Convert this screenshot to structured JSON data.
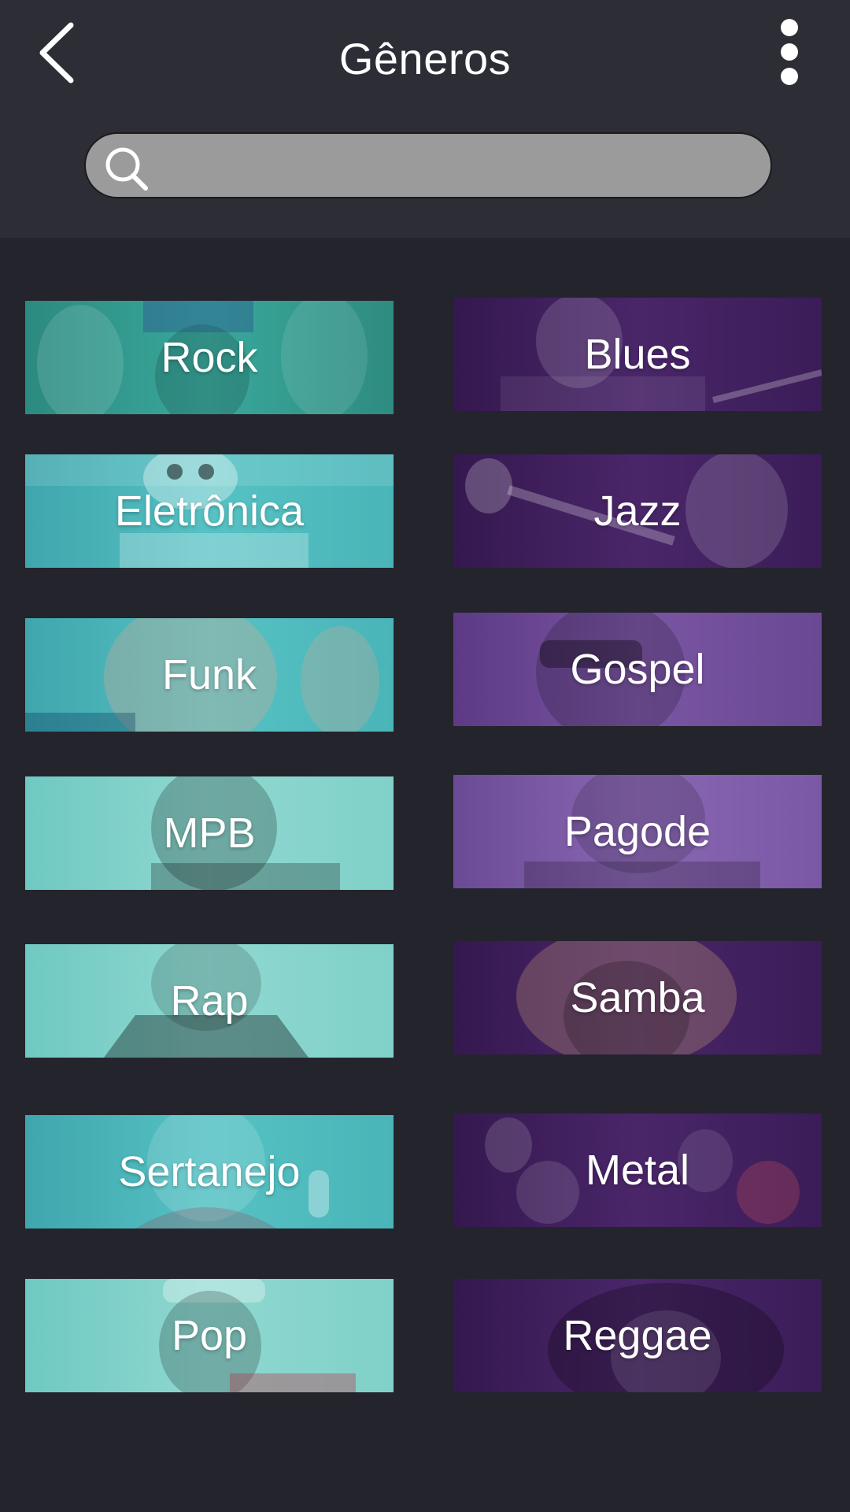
{
  "header": {
    "title": "Gêneros",
    "back_icon": "chevron-left-icon",
    "menu_icon": "more-vertical-icon"
  },
  "search": {
    "placeholder": "",
    "value": "",
    "icon": "search-icon"
  },
  "genres": [
    {
      "label": "Rock",
      "color": "#2f9185"
    },
    {
      "label": "Blues",
      "color": "#3d1d5a"
    },
    {
      "label": "Eletrônica",
      "color": "#3a9ba3"
    },
    {
      "label": "Jazz",
      "color": "#3e1f5c"
    },
    {
      "label": "Funk",
      "color": "#4ab8bb"
    },
    {
      "label": "Gospel",
      "color": "#7a55a3"
    },
    {
      "label": "MPB",
      "color": "#84d3cb"
    },
    {
      "label": "Pagode",
      "color": "#8462ad"
    },
    {
      "label": "Rap",
      "color": "#8bd6ce"
    },
    {
      "label": "Samba",
      "color": "#452566"
    },
    {
      "label": "Sertanejo",
      "color": "#58bfc0"
    },
    {
      "label": "Metal",
      "color": "#3a1c56"
    },
    {
      "label": "Pop",
      "color": "#8fd8d0"
    },
    {
      "label": "Reggae",
      "color": "#4a2669"
    }
  ]
}
